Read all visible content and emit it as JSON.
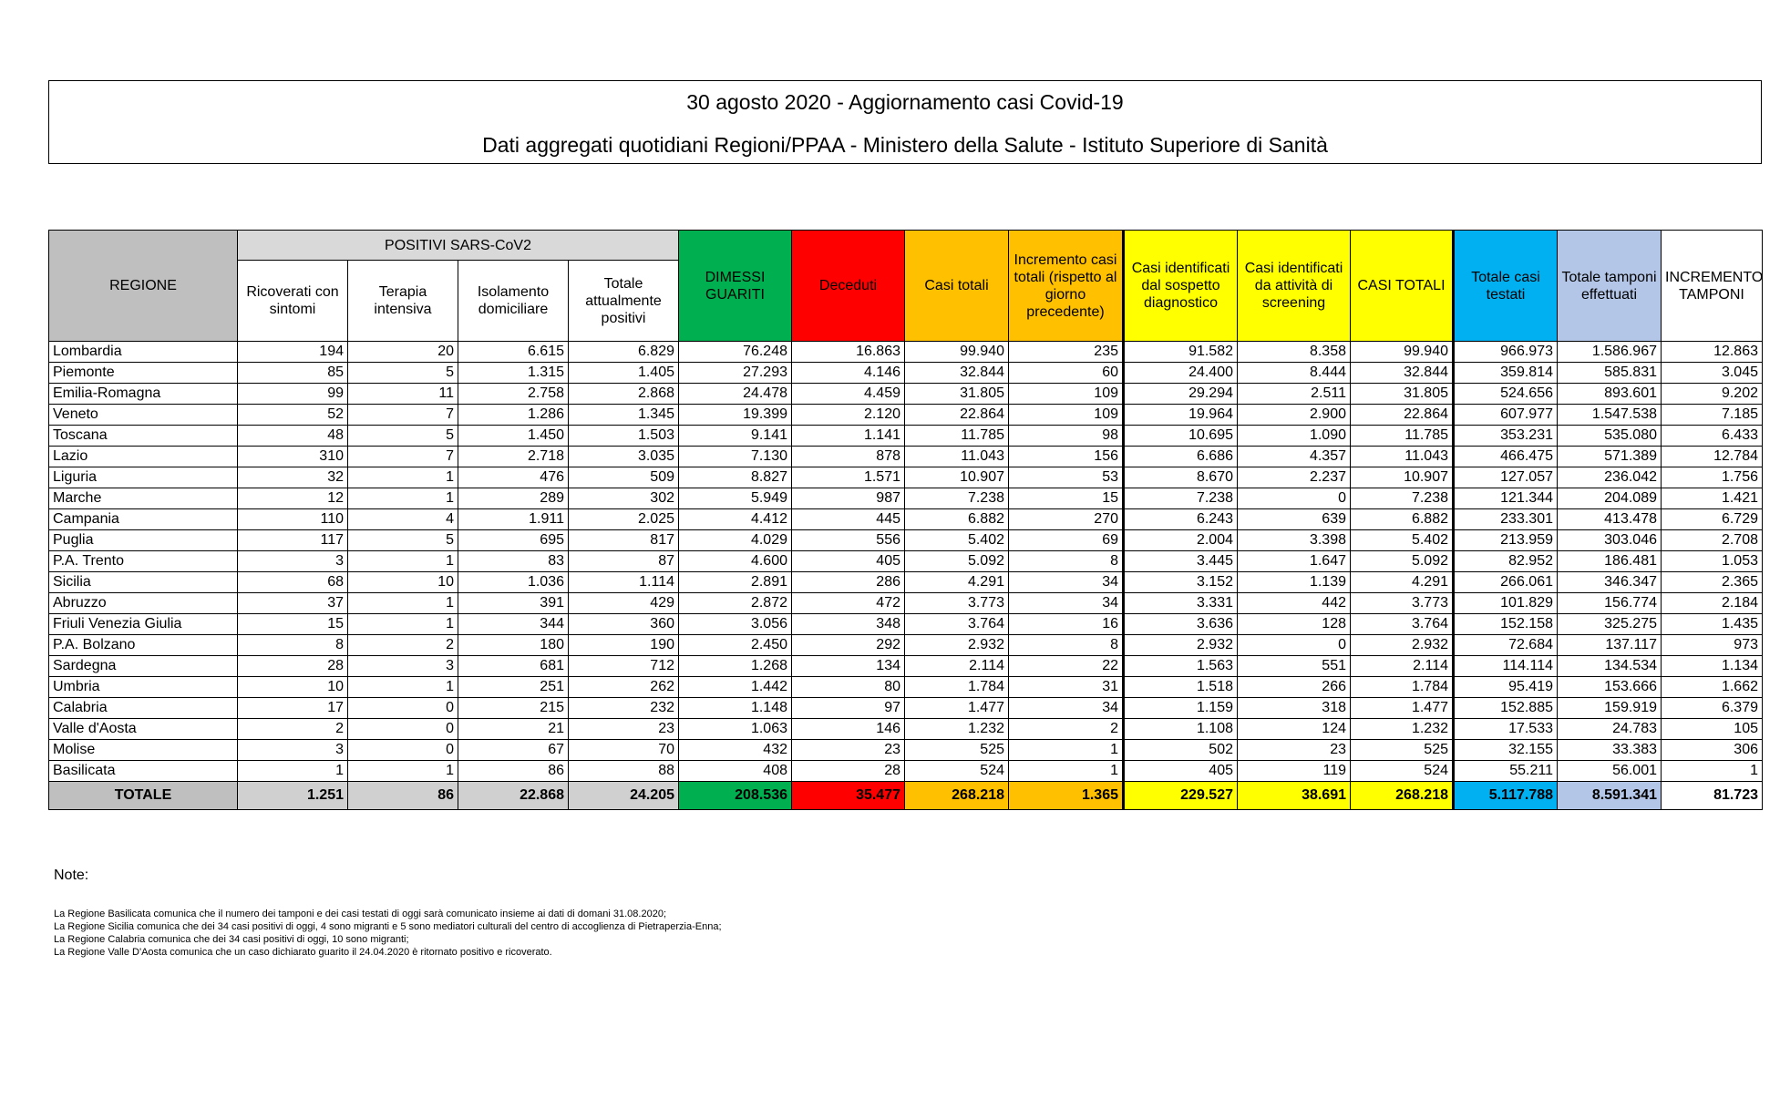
{
  "header": {
    "title": "30 agosto 2020 - Aggiornamento casi Covid-19",
    "subtitle": "Dati aggregati quotidiani Regioni/PPAA - Ministero della Salute - Istituto Superiore di Sanità"
  },
  "table": {
    "regione_label": "REGIONE",
    "positivi_group": "POSITIVI SARS-CoV2",
    "columns": [
      "Ricoverati con sintomi",
      "Terapia intensiva",
      "Isolamento domiciliare",
      "Totale attualmente positivi",
      "DIMESSI GUARITI",
      "Deceduti",
      "Casi totali",
      "Incremento casi totali (rispetto al giorno precedente)",
      "Casi identificati dal sospetto diagnostico",
      "Casi identificati da attività di screening",
      "CASI TOTALI",
      "Totale casi testati",
      "Totale tamponi effettuati",
      "INCREMENTO TAMPONI"
    ],
    "rows": [
      {
        "name": "Lombardia",
        "values": [
          "194",
          "20",
          "6.615",
          "6.829",
          "76.248",
          "16.863",
          "99.940",
          "235",
          "91.582",
          "8.358",
          "99.940",
          "966.973",
          "1.586.967",
          "12.863"
        ]
      },
      {
        "name": "Piemonte",
        "values": [
          "85",
          "5",
          "1.315",
          "1.405",
          "27.293",
          "4.146",
          "32.844",
          "60",
          "24.400",
          "8.444",
          "32.844",
          "359.814",
          "585.831",
          "3.045"
        ]
      },
      {
        "name": "Emilia-Romagna",
        "values": [
          "99",
          "11",
          "2.758",
          "2.868",
          "24.478",
          "4.459",
          "31.805",
          "109",
          "29.294",
          "2.511",
          "31.805",
          "524.656",
          "893.601",
          "9.202"
        ]
      },
      {
        "name": "Veneto",
        "values": [
          "52",
          "7",
          "1.286",
          "1.345",
          "19.399",
          "2.120",
          "22.864",
          "109",
          "19.964",
          "2.900",
          "22.864",
          "607.977",
          "1.547.538",
          "7.185"
        ]
      },
      {
        "name": "Toscana",
        "values": [
          "48",
          "5",
          "1.450",
          "1.503",
          "9.141",
          "1.141",
          "11.785",
          "98",
          "10.695",
          "1.090",
          "11.785",
          "353.231",
          "535.080",
          "6.433"
        ]
      },
      {
        "name": "Lazio",
        "values": [
          "310",
          "7",
          "2.718",
          "3.035",
          "7.130",
          "878",
          "11.043",
          "156",
          "6.686",
          "4.357",
          "11.043",
          "466.475",
          "571.389",
          "12.784"
        ]
      },
      {
        "name": "Liguria",
        "values": [
          "32",
          "1",
          "476",
          "509",
          "8.827",
          "1.571",
          "10.907",
          "53",
          "8.670",
          "2.237",
          "10.907",
          "127.057",
          "236.042",
          "1.756"
        ]
      },
      {
        "name": "Marche",
        "values": [
          "12",
          "1",
          "289",
          "302",
          "5.949",
          "987",
          "7.238",
          "15",
          "7.238",
          "0",
          "7.238",
          "121.344",
          "204.089",
          "1.421"
        ]
      },
      {
        "name": "Campania",
        "values": [
          "110",
          "4",
          "1.911",
          "2.025",
          "4.412",
          "445",
          "6.882",
          "270",
          "6.243",
          "639",
          "6.882",
          "233.301",
          "413.478",
          "6.729"
        ]
      },
      {
        "name": "Puglia",
        "values": [
          "117",
          "5",
          "695",
          "817",
          "4.029",
          "556",
          "5.402",
          "69",
          "2.004",
          "3.398",
          "5.402",
          "213.959",
          "303.046",
          "2.708"
        ]
      },
      {
        "name": "P.A. Trento",
        "values": [
          "3",
          "1",
          "83",
          "87",
          "4.600",
          "405",
          "5.092",
          "8",
          "3.445",
          "1.647",
          "5.092",
          "82.952",
          "186.481",
          "1.053"
        ]
      },
      {
        "name": "Sicilia",
        "values": [
          "68",
          "10",
          "1.036",
          "1.114",
          "2.891",
          "286",
          "4.291",
          "34",
          "3.152",
          "1.139",
          "4.291",
          "266.061",
          "346.347",
          "2.365"
        ]
      },
      {
        "name": "Abruzzo",
        "values": [
          "37",
          "1",
          "391",
          "429",
          "2.872",
          "472",
          "3.773",
          "34",
          "3.331",
          "442",
          "3.773",
          "101.829",
          "156.774",
          "2.184"
        ]
      },
      {
        "name": "Friuli Venezia Giulia",
        "values": [
          "15",
          "1",
          "344",
          "360",
          "3.056",
          "348",
          "3.764",
          "16",
          "3.636",
          "128",
          "3.764",
          "152.158",
          "325.275",
          "1.435"
        ]
      },
      {
        "name": "P.A. Bolzano",
        "values": [
          "8",
          "2",
          "180",
          "190",
          "2.450",
          "292",
          "2.932",
          "8",
          "2.932",
          "0",
          "2.932",
          "72.684",
          "137.117",
          "973"
        ]
      },
      {
        "name": "Sardegna",
        "values": [
          "28",
          "3",
          "681",
          "712",
          "1.268",
          "134",
          "2.114",
          "22",
          "1.563",
          "551",
          "2.114",
          "114.114",
          "134.534",
          "1.134"
        ]
      },
      {
        "name": "Umbria",
        "values": [
          "10",
          "1",
          "251",
          "262",
          "1.442",
          "80",
          "1.784",
          "31",
          "1.518",
          "266",
          "1.784",
          "95.419",
          "153.666",
          "1.662"
        ]
      },
      {
        "name": "Calabria",
        "values": [
          "17",
          "0",
          "215",
          "232",
          "1.148",
          "97",
          "1.477",
          "34",
          "1.159",
          "318",
          "1.477",
          "152.885",
          "159.919",
          "6.379"
        ]
      },
      {
        "name": "Valle d'Aosta",
        "values": [
          "2",
          "0",
          "21",
          "23",
          "1.063",
          "146",
          "1.232",
          "2",
          "1.108",
          "124",
          "1.232",
          "17.533",
          "24.783",
          "105"
        ]
      },
      {
        "name": "Molise",
        "values": [
          "3",
          "0",
          "67",
          "70",
          "432",
          "23",
          "525",
          "1",
          "502",
          "23",
          "525",
          "32.155",
          "33.383",
          "306"
        ]
      },
      {
        "name": "Basilicata",
        "values": [
          "1",
          "1",
          "86",
          "88",
          "408",
          "28",
          "524",
          "1",
          "405",
          "119",
          "524",
          "55.211",
          "56.001",
          "1"
        ]
      }
    ],
    "total": {
      "label": "TOTALE",
      "values": [
        "1.251",
        "86",
        "22.868",
        "24.205",
        "208.536",
        "35.477",
        "268.218",
        "1.365",
        "229.527",
        "38.691",
        "268.218",
        "5.117.788",
        "8.591.341",
        "81.723"
      ]
    }
  },
  "notes": {
    "title": "Note:",
    "lines": [
      "La Regione Basilicata comunica che il numero dei tamponi e dei casi testati di oggi sarà comunicato insieme ai dati di domani 31.08.2020;",
      "La Regione Sicilia comunica che dei 34 casi positivi di oggi, 4 sono migranti e 5 sono mediatori culturali del centro di accoglienza di Pietraperzia-Enna;",
      "La Regione Calabria comunica che dei 34 casi positivi di oggi, 10 sono migranti;",
      "La Regione Valle D'Aosta comunica che un caso dichiarato guarito il 24.04.2020 è ritornato positivo e ricoverato."
    ]
  },
  "colors": {
    "guariti": "#00b050",
    "deceduti": "#ff0000",
    "casi": "#ffc000",
    "casi_identificati": "#ffff00",
    "testati": "#00b0f0",
    "tamponi": "#b4c6e7",
    "regione_header": "#bfbfbf"
  }
}
